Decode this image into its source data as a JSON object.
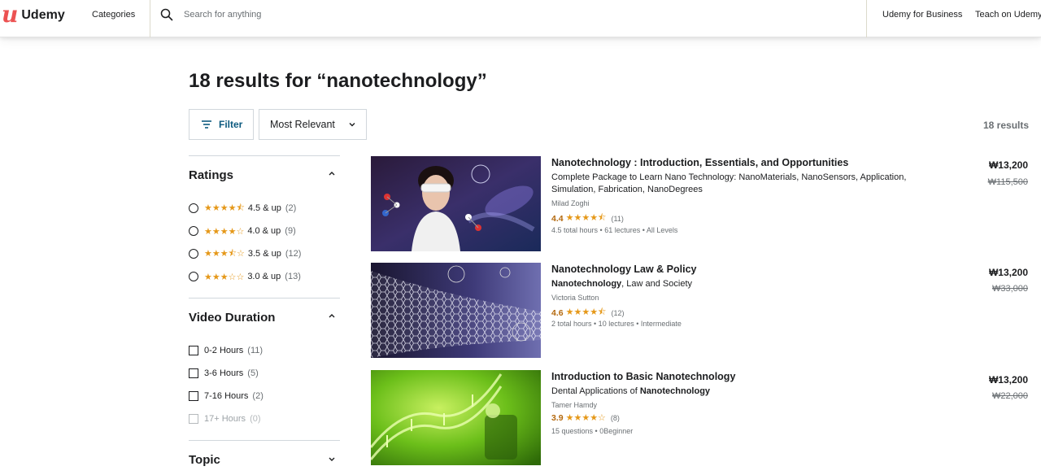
{
  "header": {
    "logo_text": "Udemy",
    "categories_label": "Categories",
    "search_placeholder": "Search for anything",
    "business_link": "Udemy for Business",
    "teach_link": "Teach on Udemy"
  },
  "page": {
    "title": "18 results for “nanotechnology”",
    "filter_label": "Filter",
    "sort_value": "Most Relevant",
    "result_count": "18 results"
  },
  "sidebar": {
    "ratings": {
      "heading": "Ratings",
      "options": [
        {
          "stars": "★★★★⯪",
          "label": "4.5 & up",
          "count": "(2)"
        },
        {
          "stars": "★★★★☆",
          "label": "4.0 & up",
          "count": "(9)"
        },
        {
          "stars": "★★★⯪☆",
          "label": "3.5 & up",
          "count": "(12)"
        },
        {
          "stars": "★★★☆☆",
          "label": "3.0 & up",
          "count": "(13)"
        }
      ]
    },
    "duration": {
      "heading": "Video Duration",
      "options": [
        {
          "label": "0-2 Hours",
          "count": "(11)"
        },
        {
          "label": "3-6 Hours",
          "count": "(5)"
        },
        {
          "label": "7-16 Hours",
          "count": "(2)"
        },
        {
          "label": "17+ Hours",
          "count": "(0)"
        }
      ]
    },
    "topic": {
      "heading": "Topic"
    }
  },
  "courses": [
    {
      "title": "Nanotechnology : Introduction, Essentials, and Opportunities",
      "desc": "Complete Package to Learn Nano Technology: NanoMaterials, NanoSensors, Application, Simulation, Fabrication, NanoDegrees",
      "author": "Milad Zoghi",
      "rating": "4.4",
      "stars": "★★★★⯪",
      "reviews": "(11)",
      "meta": "4.5 total hours • 61 lectures • All Levels",
      "price": "₩13,200",
      "old_price": "₩115,500"
    },
    {
      "title": "Nanotechnology Law & Policy",
      "desc_bold": "Nanotechnology",
      "desc_rest": ", Law and Society",
      "author": "Victoria Sutton",
      "rating": "4.6",
      "stars": "★★★★⯪",
      "reviews": "(12)",
      "meta": "2 total hours • 10 lectures • Intermediate",
      "price": "₩13,200",
      "old_price": "₩33,000"
    },
    {
      "title": "Introduction to Basic Nanotechnology",
      "desc_rest": "Dental Applications of ",
      "desc_bold": "Nanotechnology",
      "author": "Tamer Hamdy",
      "rating": "3.9",
      "stars": "★★★★☆",
      "reviews": "(8)",
      "meta": "15 questions • 0Beginner",
      "price": "₩13,200",
      "old_price": "₩22,000"
    }
  ]
}
